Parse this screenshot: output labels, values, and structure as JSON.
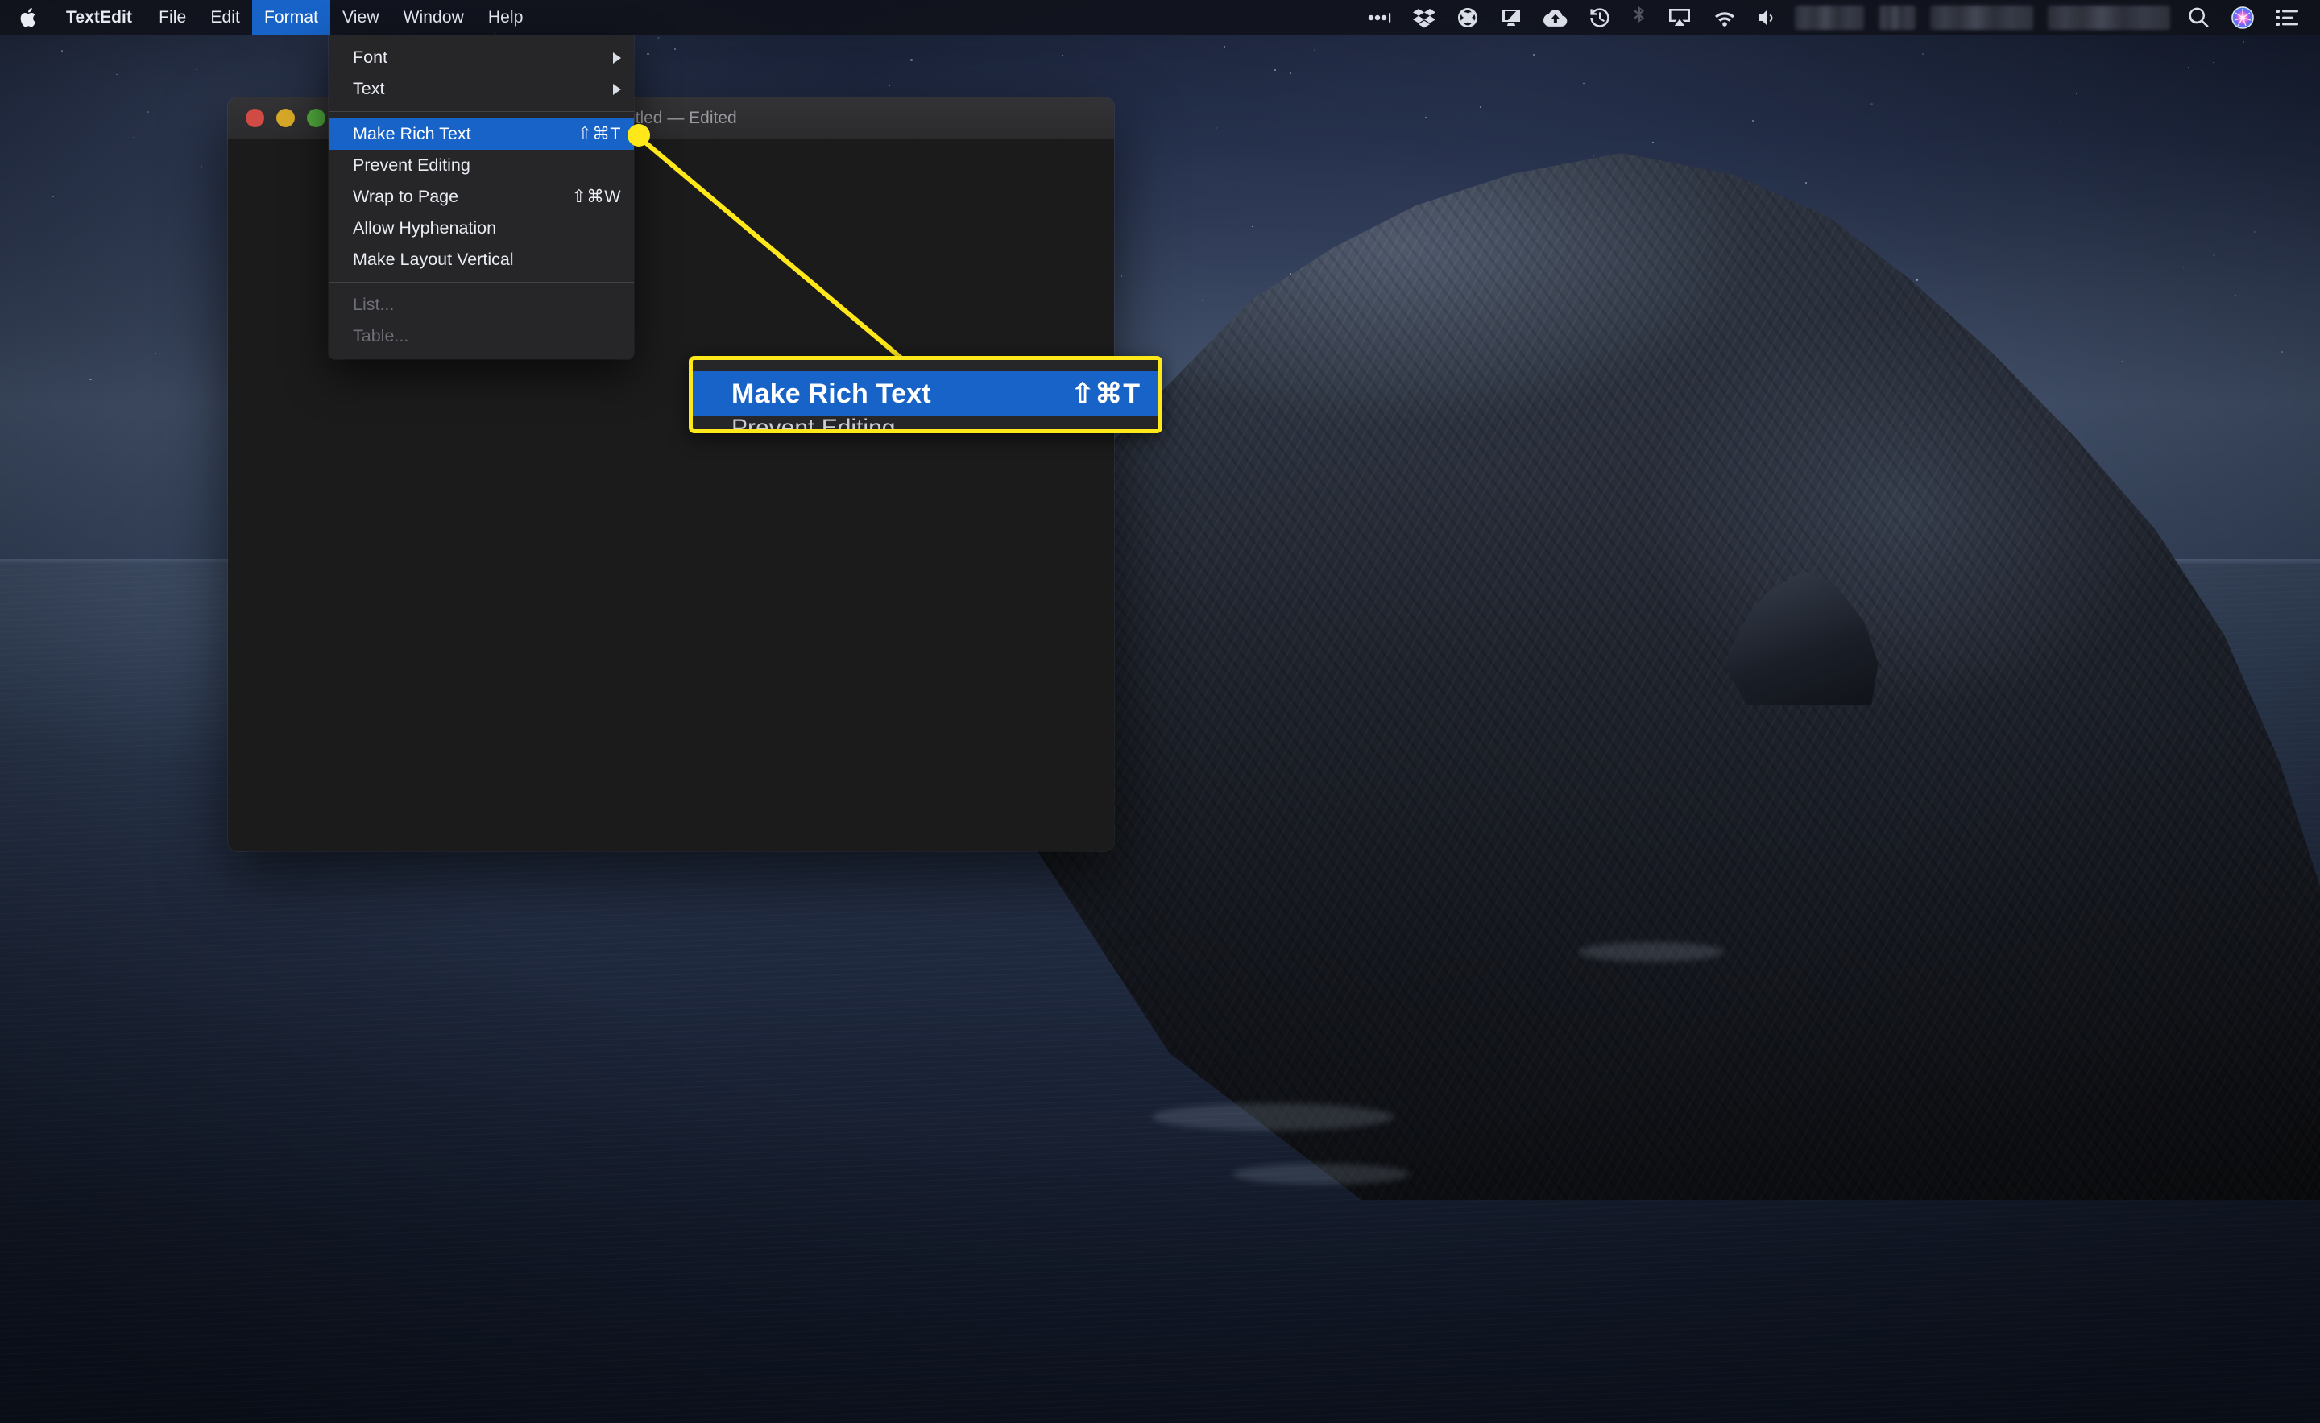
{
  "menubar": {
    "apple_icon": "apple-logo-icon",
    "app_name": "TextEdit",
    "items": [
      {
        "label": "File",
        "active": false
      },
      {
        "label": "Edit",
        "active": false
      },
      {
        "label": "Format",
        "active": true
      },
      {
        "label": "View",
        "active": false
      },
      {
        "label": "Window",
        "active": false
      },
      {
        "label": "Help",
        "active": false
      }
    ],
    "status_icons": [
      {
        "name": "ellipsis-icon",
        "dim": false
      },
      {
        "name": "dropbox-icon",
        "dim": false
      },
      {
        "name": "creative-cloud-icon",
        "dim": false
      },
      {
        "name": "display-icon",
        "dim": false
      },
      {
        "name": "cloud-upload-icon",
        "dim": false
      },
      {
        "name": "time-machine-icon",
        "dim": false
      },
      {
        "name": "bluetooth-icon",
        "dim": true
      },
      {
        "name": "airplay-icon",
        "dim": false
      },
      {
        "name": "wifi-icon",
        "dim": false
      },
      {
        "name": "volume-icon",
        "dim": false
      }
    ],
    "redacted_count": 4,
    "trailing_icons": [
      {
        "name": "spotlight-search-icon"
      },
      {
        "name": "siri-icon"
      },
      {
        "name": "control-center-icon"
      }
    ],
    "highlight_color": "#1763c7"
  },
  "window": {
    "title": "Untitled — Edited",
    "traffic_lights": [
      {
        "name": "close-button",
        "color": "#cf4b44"
      },
      {
        "name": "minimize-button",
        "color": "#d6a828"
      },
      {
        "name": "zoom-button",
        "color": "#4fa83a"
      }
    ],
    "body_color": "#1b1b1b"
  },
  "format_menu": {
    "groups": [
      [
        {
          "label": "Font",
          "shortcut": "",
          "submenu": true,
          "disabled": false,
          "selected": false
        },
        {
          "label": "Text",
          "shortcut": "",
          "submenu": true,
          "disabled": false,
          "selected": false
        }
      ],
      [
        {
          "label": "Make Rich Text",
          "shortcut": "⇧⌘T",
          "submenu": false,
          "disabled": false,
          "selected": true
        },
        {
          "label": "Prevent Editing",
          "shortcut": "",
          "submenu": false,
          "disabled": false,
          "selected": false
        },
        {
          "label": "Wrap to Page",
          "shortcut": "⇧⌘W",
          "submenu": false,
          "disabled": false,
          "selected": false
        },
        {
          "label": "Allow Hyphenation",
          "shortcut": "",
          "submenu": false,
          "disabled": false,
          "selected": false
        },
        {
          "label": "Make Layout Vertical",
          "shortcut": "",
          "submenu": false,
          "disabled": false,
          "selected": false
        }
      ],
      [
        {
          "label": "List...",
          "shortcut": "",
          "submenu": false,
          "disabled": true,
          "selected": false
        },
        {
          "label": "Table...",
          "shortcut": "",
          "submenu": false,
          "disabled": true,
          "selected": false
        }
      ]
    ]
  },
  "callout": {
    "label": "Make Rich Text",
    "shortcut": "⇧⌘T",
    "partial_below": "Prevent Editing",
    "border_color": "#ffe81a",
    "highlight_color": "#1763c7"
  }
}
